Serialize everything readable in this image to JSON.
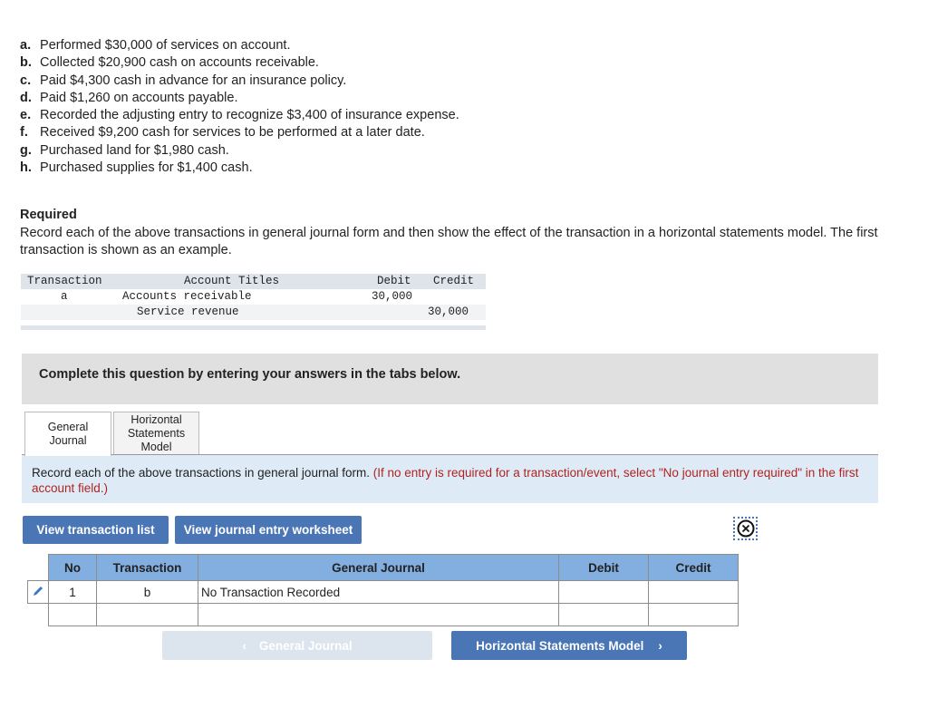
{
  "transactions": [
    {
      "letter": "a.",
      "text": "Performed $30,000 of services on account."
    },
    {
      "letter": "b.",
      "text": "Collected $20,900 cash on accounts receivable."
    },
    {
      "letter": "c.",
      "text": "Paid $4,300 cash in advance for an insurance policy."
    },
    {
      "letter": "d.",
      "text": "Paid $1,260 on accounts payable."
    },
    {
      "letter": "e.",
      "text": "Recorded the adjusting entry to recognize $3,400 of insurance expense."
    },
    {
      "letter": "f.",
      "text": "Received $9,200 cash for services to be performed at a later date."
    },
    {
      "letter": "g.",
      "text": "Purchased land for $1,980 cash."
    },
    {
      "letter": "h.",
      "text": "Purchased supplies for $1,400 cash."
    }
  ],
  "required": {
    "title": "Required",
    "text": "Record each of the above transactions in general journal form and then show the effect of the transaction in a horizontal statements model. The first transaction is shown as an example."
  },
  "example": {
    "headers": {
      "transaction": "Transaction",
      "account": "Account Titles",
      "debit": "Debit",
      "credit": "Credit"
    },
    "rows": [
      {
        "transaction": "a",
        "account": "Accounts receivable",
        "debit": "30,000",
        "credit": ""
      },
      {
        "transaction": "",
        "account": "Service revenue",
        "debit": "",
        "credit": "30,000"
      }
    ]
  },
  "complete_prompt": "Complete this question by entering your answers in the tabs below.",
  "tabs": [
    {
      "label": "General Journal",
      "active": true
    },
    {
      "label": "Horizontal Statements Model",
      "active": false
    }
  ],
  "instruction": {
    "text": "Record each of the above transactions in general journal form.",
    "note": "(If no entry is required for a transaction/event, select \"No journal entry required\" in the first account field.)"
  },
  "buttons": {
    "view_list": "View transaction list",
    "view_worksheet": "View journal entry worksheet"
  },
  "journal": {
    "headers": {
      "no": "No",
      "transaction": "Transaction",
      "general_journal": "General Journal",
      "debit": "Debit",
      "credit": "Credit"
    },
    "rows": [
      {
        "no": "1",
        "transaction": "b",
        "general_journal": "No Transaction Recorded",
        "debit": "",
        "credit": ""
      },
      {
        "no": "",
        "transaction": "",
        "general_journal": "",
        "debit": "",
        "credit": ""
      }
    ]
  },
  "nav": {
    "prev_label": "General Journal",
    "next_label": "Horizontal Statements Model"
  }
}
